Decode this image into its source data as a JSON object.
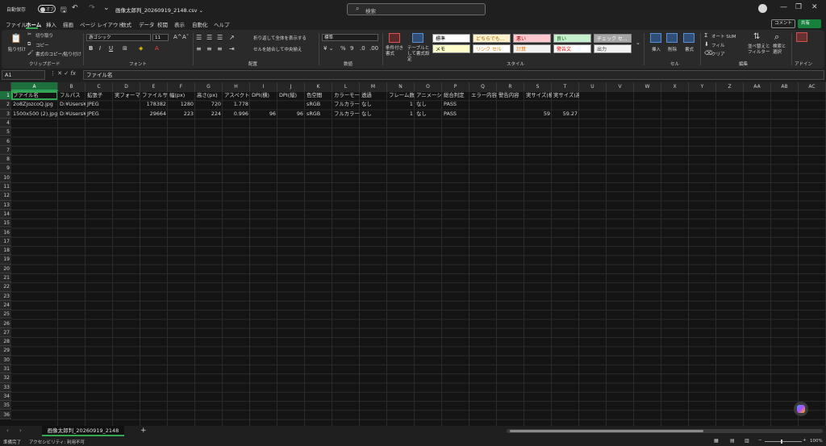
{
  "titlebar": {
    "autosave_label": "自動保存",
    "autosave_state": "オフ",
    "doc_title": "画像太郎判_20260919_2148.csv ⌄",
    "search_placeholder": "検索"
  },
  "menu": {
    "items": [
      "ファイル",
      "ホーム",
      "挿入",
      "描画",
      "ページ レイアウト",
      "数式",
      "データ",
      "校閲",
      "表示",
      "自動化",
      "ヘルプ"
    ],
    "active": "ホーム",
    "comment_label": "コメント",
    "share_label": "共有"
  },
  "ribbon": {
    "clipboard": {
      "paste": "貼り付け",
      "cut": "切り取り",
      "copy": "コピー",
      "format_painter": "書式のコピー/貼り付け",
      "label": "クリップボード"
    },
    "font": {
      "name": "游ゴシック",
      "size": "11",
      "label": "フォント"
    },
    "alignment": {
      "wrap": "折り返して全体を表示する",
      "merge": "セルを結合して中央揃え",
      "label": "配置"
    },
    "number": {
      "format": "標準",
      "label": "数値"
    },
    "styles": {
      "conditional": "条件付き書式",
      "table": "テーブルとして書式設定",
      "cells": [
        {
          "text": "標準",
          "bg": "#ffffff",
          "fg": "#000000"
        },
        {
          "text": "どちらでも...",
          "bg": "#fff2cc",
          "fg": "#9c6500"
        },
        {
          "text": "悪い",
          "bg": "#ffc7ce",
          "fg": "#9c0006"
        },
        {
          "text": "良い",
          "bg": "#c6efce",
          "fg": "#006100"
        },
        {
          "text": "チェック セ...",
          "bg": "#a5a5a5",
          "fg": "#ffffff"
        },
        {
          "text": "メモ",
          "bg": "#ffffcc",
          "fg": "#000000"
        },
        {
          "text": "リンク セル",
          "bg": "#ffffff",
          "fg": "#fa7d00"
        },
        {
          "text": "計算",
          "bg": "#f2f2f2",
          "fg": "#fa7d00"
        },
        {
          "text": "警告文",
          "bg": "#ffffff",
          "fg": "#ff0000"
        },
        {
          "text": "出力",
          "bg": "#f2f2f2",
          "fg": "#3f3f3f"
        }
      ],
      "label": "スタイル"
    },
    "cells": {
      "insert": "挿入",
      "delete": "削除",
      "format": "書式",
      "label": "セル"
    },
    "editing": {
      "autosum": "オート SUM",
      "fill": "フィル",
      "clear": "クリア",
      "sort": "並べ替えとフィルター",
      "find": "検索と選択",
      "label": "編集"
    },
    "addins": {
      "label": "アドイン"
    }
  },
  "formula_bar": {
    "name_box": "A1",
    "fx": "fx",
    "content": "ファイル名"
  },
  "sheet": {
    "columns": [
      "A",
      "B",
      "C",
      "D",
      "E",
      "F",
      "G",
      "H",
      "I",
      "J",
      "K",
      "L",
      "M",
      "N",
      "O",
      "P",
      "Q",
      "R",
      "S",
      "T",
      "U",
      "V",
      "W",
      "X",
      "Y",
      "Z",
      "AA",
      "AB",
      "AC"
    ],
    "selected_column": "A",
    "selected_row": "1",
    "rows": [
      "1",
      "2",
      "3",
      "4",
      "5",
      "6",
      "7",
      "8",
      "9",
      "10",
      "11",
      "12",
      "13",
      "14",
      "15",
      "16",
      "17",
      "18",
      "19",
      "20",
      "21",
      "22",
      "23",
      "24",
      "25",
      "26",
      "27",
      "28",
      "29",
      "30",
      "31",
      "32",
      "33",
      "34",
      "35",
      "36"
    ],
    "header": [
      "ファイル名",
      "フルパス",
      "拡張子",
      "実フォーマット",
      "ファイルサイズ",
      "幅(px)",
      "高さ(px)",
      "アスペクト比",
      "DPI(横)",
      "DPI(縦)",
      "色空間",
      "カラーモード",
      "透過",
      "フレーム数",
      "アニメーション",
      "総合判定",
      "エラー内容",
      "警告内容",
      "実サイズ(横mm)",
      "実サイズ(高さmm)"
    ],
    "data": [
      [
        "2o8ZjozcoQ.jpg",
        "D:¥Users¥.jpg",
        "JPEG",
        "",
        "178382",
        "1280",
        "720",
        "1.778",
        "",
        "",
        "sRGB",
        "フルカラー",
        "なし",
        "1",
        "なし",
        "PASS",
        "",
        "",
        "",
        ""
      ],
      [
        "1500x500 (2).jpg",
        "D:¥Users¥.jpg",
        "JPEG",
        "",
        "29664",
        "223",
        "224",
        "0.996",
        "96",
        "96",
        "sRGB",
        "フルカラー",
        "なし",
        "1",
        "なし",
        "PASS",
        "",
        "",
        "59",
        "59.27"
      ]
    ]
  },
  "tabs": {
    "sheet_name": "画像太郎判_20260919_2148",
    "add": "+"
  },
  "status": {
    "ready": "準備完了",
    "accessibility": "アクセシビリティ: 利用不可",
    "zoom": "100%"
  }
}
